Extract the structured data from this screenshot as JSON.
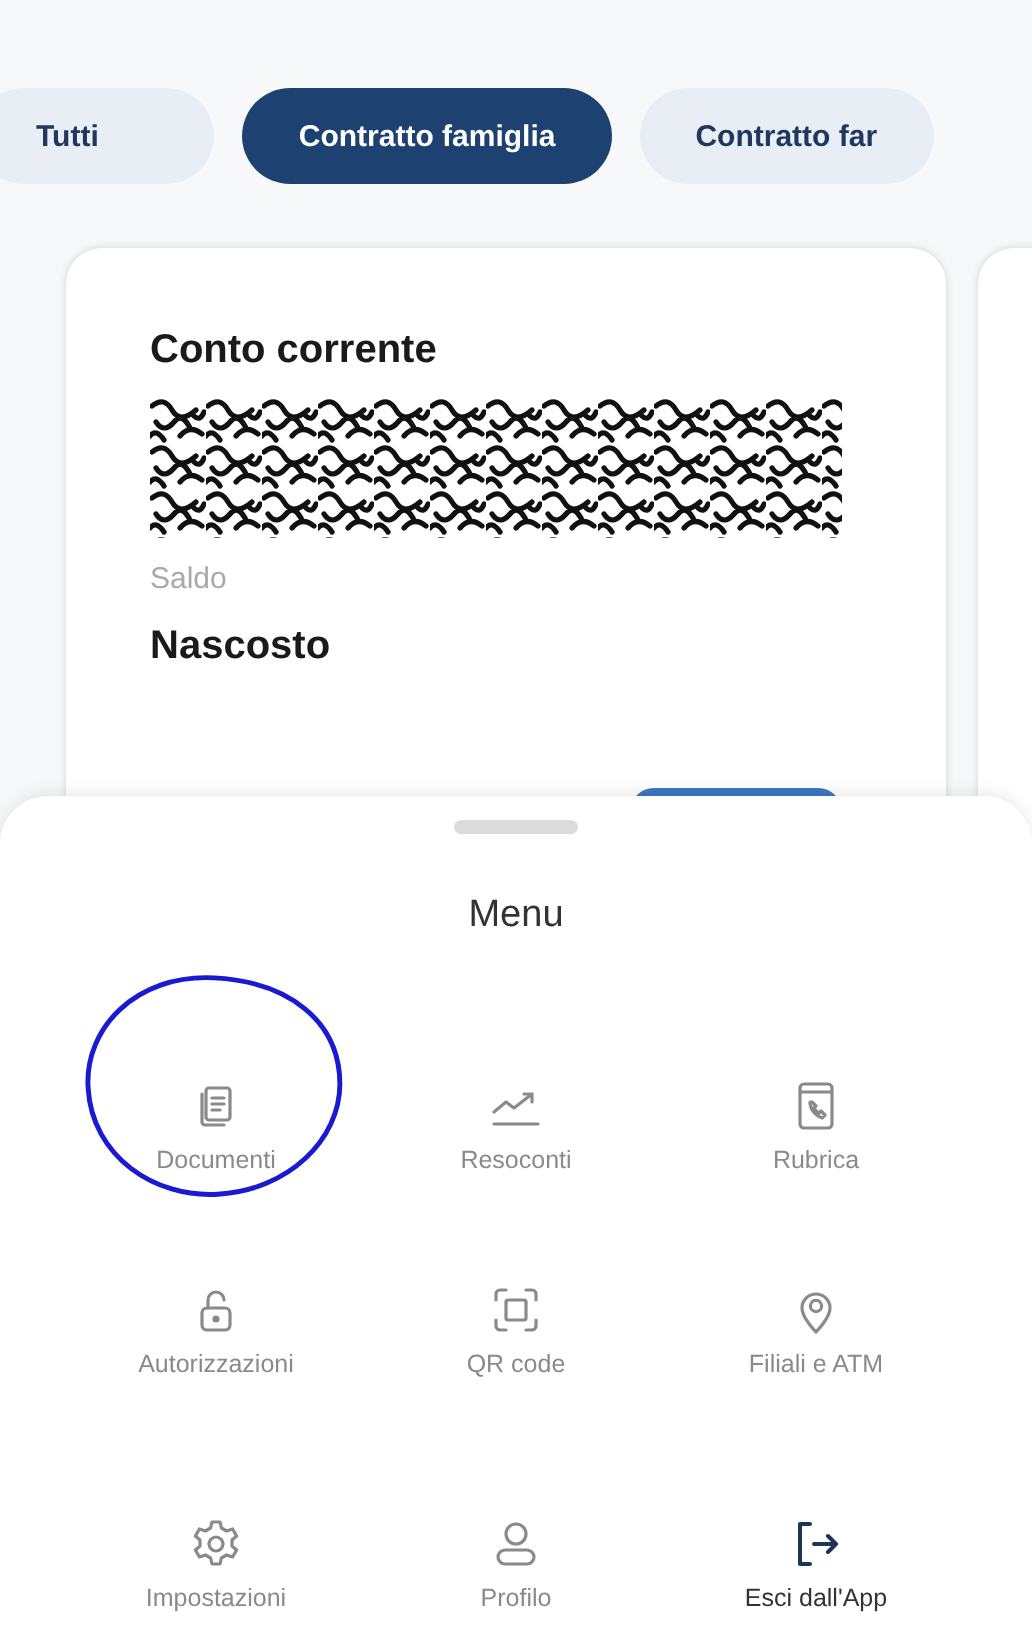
{
  "tabs": [
    {
      "label": "Tutti",
      "selected": false
    },
    {
      "label": "Contratto famiglia",
      "selected": true
    },
    {
      "label": "Contratto far",
      "selected": false
    }
  ],
  "card": {
    "title": "Conto corrente",
    "balance_label": "Saldo",
    "balance_value": "Nascosto"
  },
  "menu": {
    "title": "Menu",
    "items": [
      {
        "label": "Documenti",
        "kind": "documents",
        "circled": true
      },
      {
        "label": "Resoconti",
        "kind": "chart",
        "circled": false
      },
      {
        "label": "Rubrica",
        "kind": "contacts",
        "circled": false
      },
      {
        "label": "Autorizzazioni",
        "kind": "lock",
        "circled": false
      },
      {
        "label": "QR code",
        "kind": "qr",
        "circled": false
      },
      {
        "label": "Filiali e ATM",
        "kind": "pin",
        "circled": false
      },
      {
        "label": "Impostazioni",
        "kind": "settings",
        "circled": false
      },
      {
        "label": "Profilo",
        "kind": "profile",
        "circled": false
      },
      {
        "label": "Esci dall'App",
        "kind": "exit",
        "circled": false
      }
    ]
  }
}
